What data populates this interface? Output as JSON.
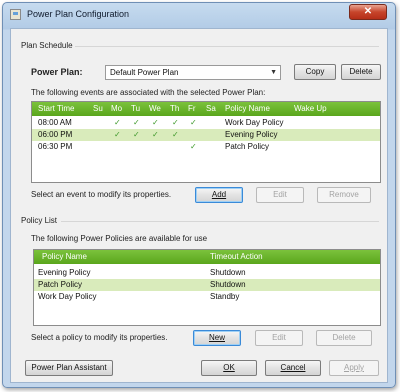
{
  "window": {
    "title": "Power Plan Configuration",
    "close_glyph": "✕"
  },
  "schedule": {
    "group_label": "Plan Schedule",
    "power_plan_label": "Power Plan:",
    "power_plan_value": "Default Power Plan",
    "copy_label": "Copy",
    "delete_label": "Delete",
    "events_caption": "The following events are associated with the selected Power Plan:",
    "columns": [
      "Start Time",
      "Su",
      "Mo",
      "Tu",
      "We",
      "Th",
      "Fr",
      "Sa",
      "Policy Name",
      "Wake Up"
    ],
    "rows": [
      {
        "time": "08:00 AM",
        "days": [
          "",
          "✓",
          "✓",
          "✓",
          "✓",
          "✓",
          ""
        ],
        "policy": "Work Day Policy",
        "wake": ""
      },
      {
        "time": "06:00 PM",
        "days": [
          "",
          "✓",
          "✓",
          "✓",
          "✓",
          "",
          ""
        ],
        "policy": "Evening Policy",
        "wake": ""
      },
      {
        "time": "06:30 PM",
        "days": [
          "",
          "",
          "",
          "",
          "",
          "✓",
          ""
        ],
        "policy": "Patch Policy",
        "wake": ""
      }
    ],
    "select_event_text": "Select an event to modify its properties.",
    "add_label": "Add",
    "edit_label": "Edit",
    "remove_label": "Remove"
  },
  "policy_list": {
    "group_label": "Policy List",
    "caption": "The following Power Policies are available for use",
    "columns": [
      "Policy Name",
      "Timeout Action"
    ],
    "rows": [
      {
        "name": "Evening Policy",
        "action": "Shutdown"
      },
      {
        "name": "Patch Policy",
        "action": "Shutdown"
      },
      {
        "name": "Work Day Policy",
        "action": "Standby"
      }
    ],
    "select_policy_text": "Select a policy to modify its properties.",
    "new_label": "New",
    "edit_label": "Edit",
    "delete_label": "Delete"
  },
  "footer": {
    "assistant_label": "Power Plan Assistant",
    "ok_label": "OK",
    "cancel_label": "Cancel",
    "apply_label": "Apply"
  },
  "colors": {
    "grid_header": "#6bb62c",
    "alt_row": "#d9ebbb",
    "check": "#3f9a2c"
  }
}
